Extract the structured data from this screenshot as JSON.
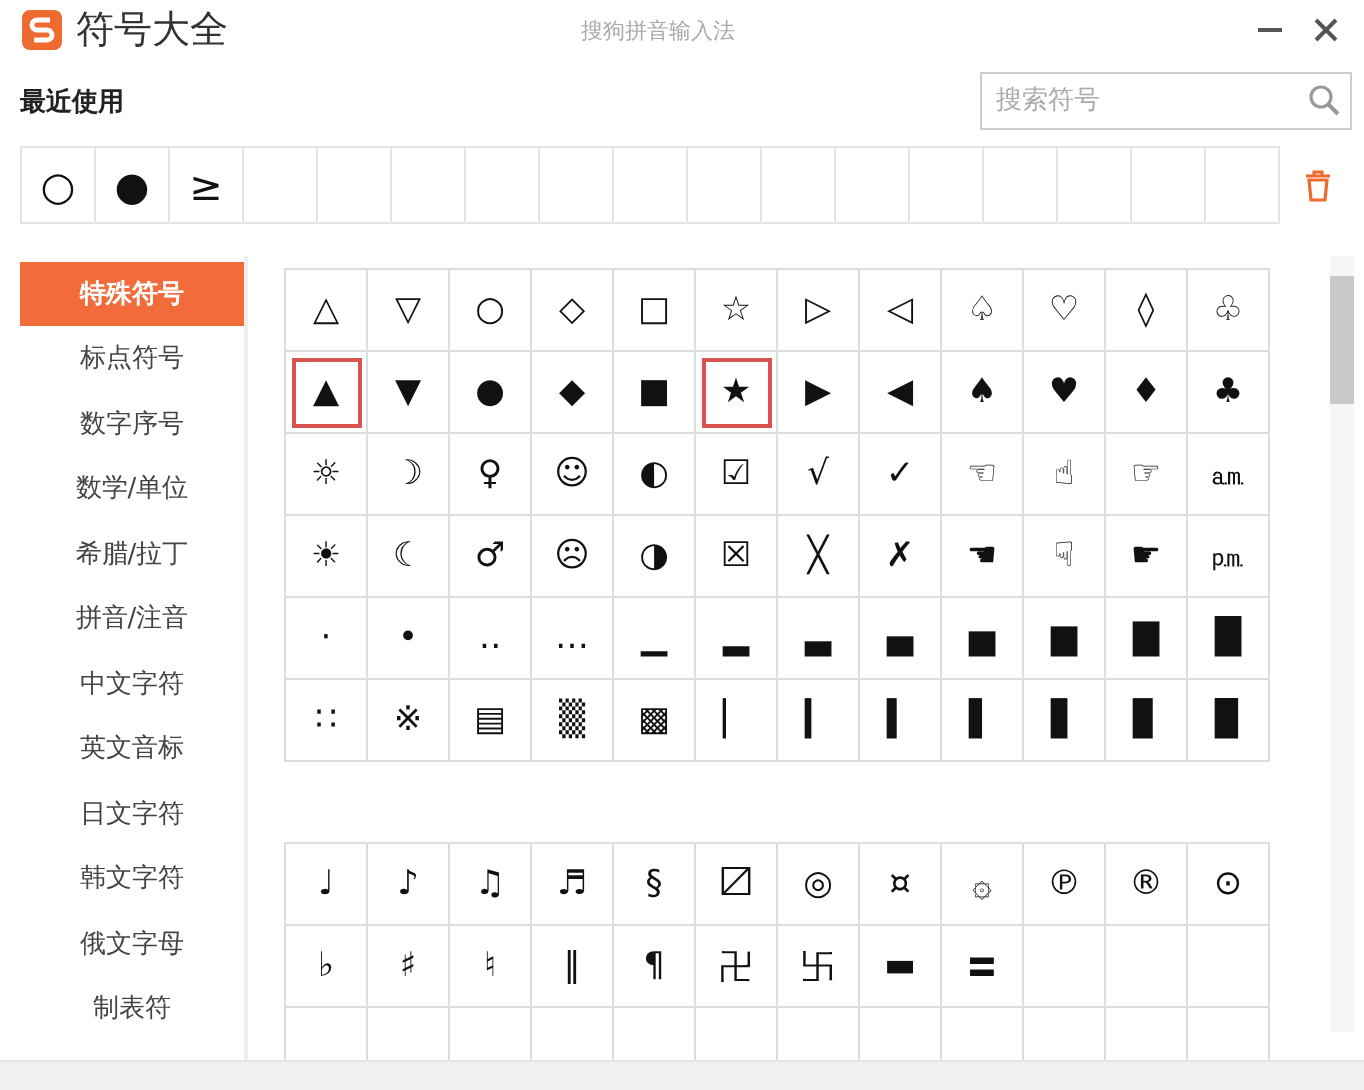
{
  "window": {
    "title": "符号大全",
    "app_name": "搜狗拼音输入法"
  },
  "recent": {
    "label": "最近使用",
    "symbols": [
      "○",
      "●",
      "≥"
    ]
  },
  "search": {
    "placeholder": "搜索符号"
  },
  "sidebar": {
    "items": [
      {
        "label": "特殊符号",
        "selected": true
      },
      {
        "label": "标点符号",
        "selected": false
      },
      {
        "label": "数字序号",
        "selected": false
      },
      {
        "label": "数学/单位",
        "selected": false
      },
      {
        "label": "希腊/拉丁",
        "selected": false
      },
      {
        "label": "拼音/注音",
        "selected": false
      },
      {
        "label": "中文字符",
        "selected": false
      },
      {
        "label": "英文音标",
        "selected": false
      },
      {
        "label": "日文字符",
        "selected": false
      },
      {
        "label": "韩文字符",
        "selected": false
      },
      {
        "label": "俄文字母",
        "selected": false
      },
      {
        "label": "制表符",
        "selected": false
      }
    ]
  },
  "groups": [
    {
      "rows": [
        [
          {
            "symbol": "△",
            "marked": false
          },
          {
            "symbol": "▽",
            "marked": false
          },
          {
            "symbol": "○",
            "marked": false
          },
          {
            "symbol": "◇",
            "marked": false
          },
          {
            "symbol": "□",
            "marked": false
          },
          {
            "symbol": "☆",
            "marked": false
          },
          {
            "symbol": "▷",
            "marked": false
          },
          {
            "symbol": "◁",
            "marked": false
          },
          {
            "symbol": "♤",
            "marked": false
          },
          {
            "symbol": "♡",
            "marked": false
          },
          {
            "symbol": "◊",
            "marked": false
          },
          {
            "symbol": "♧",
            "marked": false
          }
        ],
        [
          {
            "symbol": "▲",
            "marked": true
          },
          {
            "symbol": "▼",
            "marked": false
          },
          {
            "symbol": "●",
            "marked": false
          },
          {
            "symbol": "◆",
            "marked": false
          },
          {
            "symbol": "■",
            "marked": false
          },
          {
            "symbol": "★",
            "marked": true
          },
          {
            "symbol": "▶",
            "marked": false
          },
          {
            "symbol": "◀",
            "marked": false
          },
          {
            "symbol": "♠",
            "marked": false
          },
          {
            "symbol": "♥",
            "marked": false
          },
          {
            "symbol": "♦",
            "marked": false
          },
          {
            "symbol": "♣",
            "marked": false
          }
        ],
        [
          {
            "symbol": "☼",
            "marked": false
          },
          {
            "symbol": "☽",
            "marked": false
          },
          {
            "symbol": "♀",
            "marked": false
          },
          {
            "symbol": "☺",
            "marked": false
          },
          {
            "symbol": "◐",
            "marked": false
          },
          {
            "symbol": "☑",
            "marked": false
          },
          {
            "symbol": "√",
            "marked": false
          },
          {
            "symbol": "✓",
            "marked": false
          },
          {
            "symbol": "☜",
            "marked": false
          },
          {
            "symbol": "☝",
            "marked": false
          },
          {
            "symbol": "☞",
            "marked": false
          },
          {
            "symbol": "㏂",
            "marked": false
          }
        ],
        [
          {
            "symbol": "☀",
            "marked": false
          },
          {
            "symbol": "☾",
            "marked": false
          },
          {
            "symbol": "♂",
            "marked": false
          },
          {
            "symbol": "☹",
            "marked": false
          },
          {
            "symbol": "◑",
            "marked": false
          },
          {
            "symbol": "☒",
            "marked": false
          },
          {
            "symbol": "╳",
            "marked": false
          },
          {
            "symbol": "✗",
            "marked": false
          },
          {
            "symbol": "☚",
            "marked": false
          },
          {
            "symbol": "☟",
            "marked": false
          },
          {
            "symbol": "☛",
            "marked": false
          },
          {
            "symbol": "㏘",
            "marked": false
          }
        ],
        [
          {
            "symbol": "·",
            "marked": false
          },
          {
            "symbol": "•",
            "marked": false
          },
          {
            "symbol": "‥",
            "marked": false
          },
          {
            "symbol": "…",
            "marked": false
          },
          {
            "symbol": "▁",
            "marked": false
          },
          {
            "symbol": "▂",
            "marked": false
          },
          {
            "symbol": "▃",
            "marked": false
          },
          {
            "symbol": "▄",
            "marked": false
          },
          {
            "symbol": "▅",
            "marked": false
          },
          {
            "symbol": "▆",
            "marked": false
          },
          {
            "symbol": "▇",
            "marked": false
          },
          {
            "symbol": "█",
            "marked": false
          }
        ],
        [
          {
            "symbol": "∷",
            "marked": false
          },
          {
            "symbol": "※",
            "marked": false
          },
          {
            "symbol": "▤",
            "marked": false
          },
          {
            "symbol": "▒",
            "marked": false
          },
          {
            "symbol": "▩",
            "marked": false
          },
          {
            "symbol": "▏",
            "marked": false
          },
          {
            "symbol": "▎",
            "marked": false
          },
          {
            "symbol": "▍",
            "marked": false
          },
          {
            "symbol": "▌",
            "marked": false
          },
          {
            "symbol": "▋",
            "marked": false
          },
          {
            "symbol": "▊",
            "marked": false
          },
          {
            "symbol": "▉",
            "marked": false
          }
        ]
      ]
    },
    {
      "rows": [
        [
          {
            "symbol": "♩",
            "marked": false
          },
          {
            "symbol": "♪",
            "marked": false
          },
          {
            "symbol": "♫",
            "marked": false
          },
          {
            "symbol": "♬",
            "marked": false
          },
          {
            "symbol": "§",
            "marked": false
          },
          {
            "symbol": "〼",
            "marked": false
          },
          {
            "symbol": "◎",
            "marked": false
          },
          {
            "symbol": "¤",
            "marked": false
          },
          {
            "symbol": "۞",
            "marked": false
          },
          {
            "symbol": "℗",
            "marked": false
          },
          {
            "symbol": "®",
            "marked": false
          },
          {
            "symbol": "⊙",
            "marked": false
          }
        ],
        [
          {
            "symbol": "♭",
            "marked": false
          },
          {
            "symbol": "♯",
            "marked": false
          },
          {
            "symbol": "♮",
            "marked": false
          },
          {
            "symbol": "‖",
            "marked": false
          },
          {
            "symbol": "¶",
            "marked": false
          },
          {
            "symbol": "卍",
            "marked": false
          },
          {
            "symbol": "卐",
            "marked": false
          },
          {
            "symbol": "▬",
            "marked": false
          },
          {
            "symbol": "〓",
            "marked": false
          }
        ],
        []
      ]
    }
  ]
}
